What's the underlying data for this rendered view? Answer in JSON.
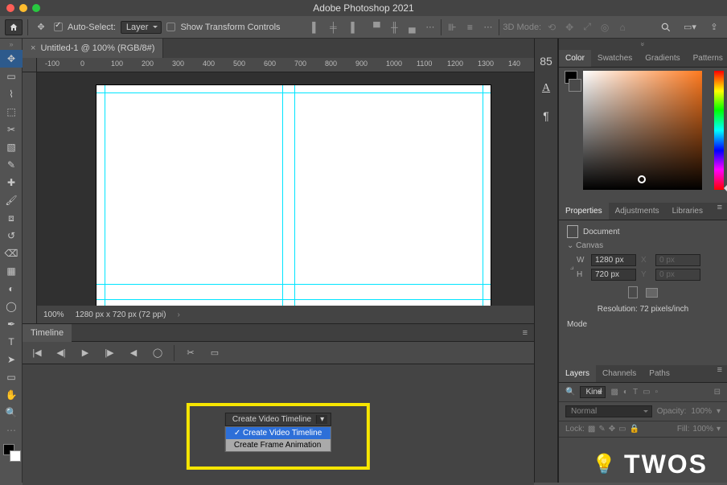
{
  "app": {
    "title": "Adobe Photoshop 2021"
  },
  "options": {
    "auto_select_label": "Auto-Select:",
    "layer_select": "Layer",
    "show_transform_label": "Show Transform Controls",
    "threeD_label": "3D Mode:"
  },
  "document": {
    "tab_title": "Untitled-1 @ 100% (RGB/8#)",
    "zoom": "100%",
    "dims": "1280 px x 720 px (72 ppi)"
  },
  "ruler_ticks": [
    "-100",
    "0",
    "100",
    "200",
    "300",
    "400",
    "500",
    "600",
    "700",
    "800",
    "900",
    "1000",
    "1100",
    "1200",
    "1300",
    "140"
  ],
  "timeline": {
    "tab": "Timeline",
    "button_label": "Create Video Timeline",
    "menu": {
      "item1": "Create Video Timeline",
      "item2": "Create Frame Animation"
    }
  },
  "dock": {
    "item1": "85",
    "item2": "A",
    "item3": "¶"
  },
  "color_panel": {
    "tabs": {
      "color": "Color",
      "swatches": "Swatches",
      "gradients": "Gradients",
      "patterns": "Patterns"
    }
  },
  "properties_panel": {
    "tabs": {
      "properties": "Properties",
      "adjustments": "Adjustments",
      "libraries": "Libraries"
    },
    "doc_label": "Document",
    "canvas_label": "Canvas",
    "w_label": "W",
    "w_value": "1280 px",
    "h_label": "H",
    "h_value": "720 px",
    "x_label": "X",
    "x_value": "0 px",
    "y_label": "Y",
    "y_value": "0 px",
    "resolution": "Resolution: 72 pixels/inch",
    "mode": "Mode"
  },
  "layers_panel": {
    "tabs": {
      "layers": "Layers",
      "channels": "Channels",
      "paths": "Paths"
    },
    "kind_label": "Kind",
    "blend_mode": "Normal",
    "opacity_label": "Opacity:",
    "opacity_value": "100%",
    "lock_label": "Lock:",
    "fill_label": "Fill:",
    "fill_value": "100%"
  },
  "watermark": "TWOS"
}
